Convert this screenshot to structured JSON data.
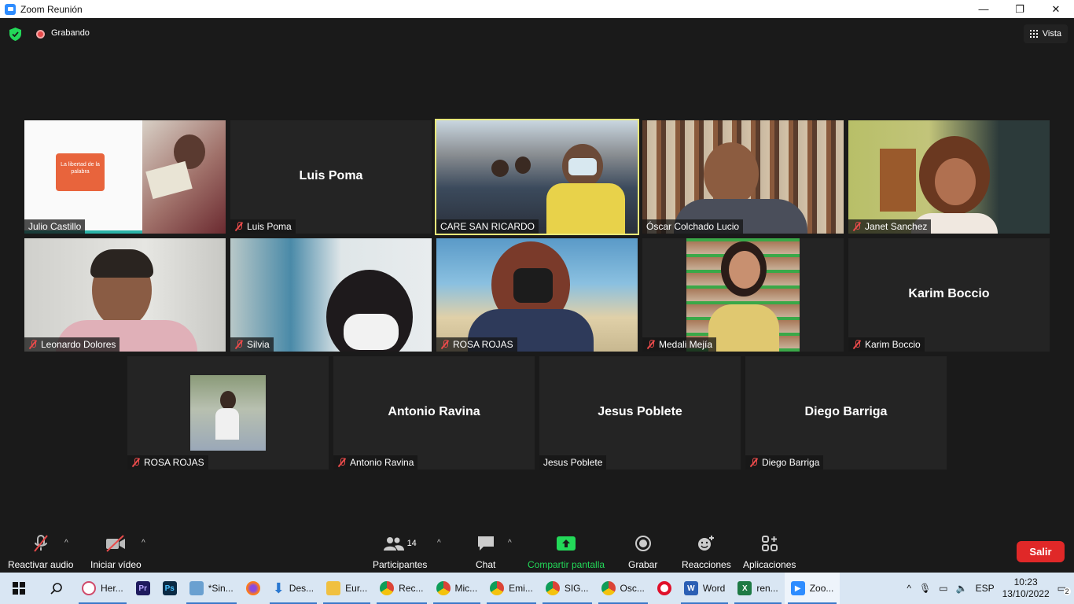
{
  "window": {
    "title": "Zoom Reunión",
    "min": "—",
    "max": "❐",
    "close": "✕"
  },
  "topbar": {
    "recording_label": "Grabando",
    "view_label": "Vista"
  },
  "participants": [
    {
      "name": "Julio Castillo",
      "muted": false,
      "video": true,
      "slide_text": "La libertad de la palabra"
    },
    {
      "name": "Luis Poma",
      "muted": true,
      "video": false
    },
    {
      "name": "CARE SAN RICARDO",
      "muted": false,
      "video": true,
      "speaking": true
    },
    {
      "name": "Óscar Colchado Lucio",
      "muted": false,
      "video": true
    },
    {
      "name": "Janet Sanchez",
      "muted": true,
      "video": true
    },
    {
      "name": "Leonardo Dolores",
      "muted": true,
      "video": true
    },
    {
      "name": "Silvia",
      "muted": true,
      "video": true
    },
    {
      "name": "ROSA ROJAS",
      "muted": true,
      "video": true
    },
    {
      "name": "Medali Mejía",
      "muted": true,
      "video": true
    },
    {
      "name": "Karim Boccio",
      "muted": true,
      "video": false
    },
    {
      "name": "ROSA ROJAS",
      "muted": true,
      "video": false,
      "has_photo": true
    },
    {
      "name": "Antonio Ravina",
      "muted": true,
      "video": false
    },
    {
      "name": "Jesus Poblete",
      "muted": false,
      "video": false
    },
    {
      "name": "Diego Barriga",
      "muted": true,
      "video": false
    }
  ],
  "toolbar": {
    "audio": "Reactivar audio",
    "video": "Iniciar vídeo",
    "participants": "Participantes",
    "participants_count": "14",
    "chat": "Chat",
    "share": "Compartir pantalla",
    "record": "Grabar",
    "reactions": "Reacciones",
    "apps": "Aplicaciones",
    "leave": "Salir"
  },
  "taskbar": {
    "items": [
      "Her...",
      "*Sin...",
      "Des...",
      "Eur...",
      "Rec...",
      "Mic...",
      "Emi...",
      "SIG...",
      "Osc...",
      "Word",
      "ren...",
      "Zoo..."
    ],
    "lang": "ESP",
    "time": "10:23",
    "date": "13/10/2022",
    "notifications": "2"
  },
  "colors": {
    "accent_share": "#23d959",
    "leave": "#e02828",
    "muted": "#e84a4a",
    "active_border": "#e8e87a"
  }
}
